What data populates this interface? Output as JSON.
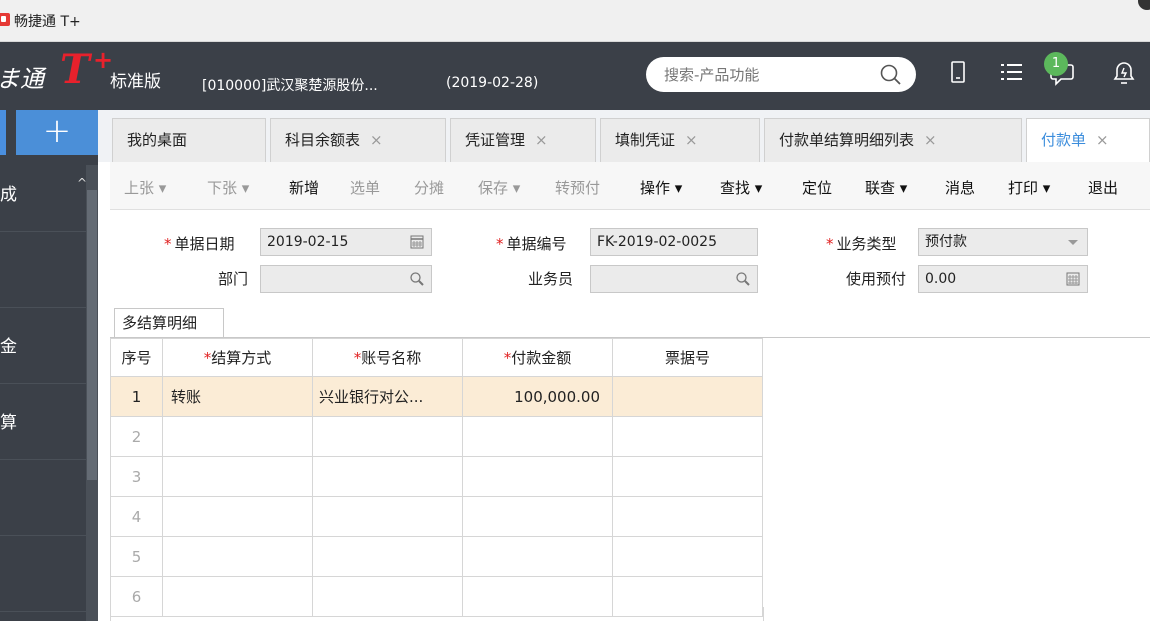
{
  "window": {
    "title": "畅捷通 T+"
  },
  "header": {
    "brand_part": "ま通",
    "brand_t": "T",
    "brand_plus": "+",
    "edition": "标准版",
    "company": "[010000]武汉聚楚源股份...",
    "date": "(2019-02-28)",
    "search_placeholder": "搜索-产品功能",
    "notification_count": "1",
    "colors": {
      "header_bg": "#3b4048",
      "brand_red": "#e8212c",
      "accent_blue": "#3c8ddc"
    }
  },
  "sidebar": {
    "add_label": "+",
    "items": [
      {
        "label": "成"
      },
      {
        "label": ""
      },
      {
        "label": "金"
      },
      {
        "label": "算"
      },
      {
        "label": ""
      },
      {
        "label": ""
      }
    ]
  },
  "tabs": [
    {
      "label": "我的桌面",
      "closable": false
    },
    {
      "label": "科目余额表",
      "closable": true
    },
    {
      "label": "凭证管理",
      "closable": true
    },
    {
      "label": "填制凭证",
      "closable": true
    },
    {
      "label": "付款单结算明细列表",
      "closable": true
    },
    {
      "label": "付款单",
      "closable": true,
      "active": true
    }
  ],
  "tab_close_glyph": "×",
  "toolbar": {
    "prev": "上张 ▾",
    "next": "下张 ▾",
    "new": "新增",
    "select": "选单",
    "split": "分摊",
    "save": "保存 ▾",
    "prepay": "转预付",
    "operate": "操作 ▾",
    "find": "查找 ▾",
    "locate": "定位",
    "link": "联查 ▾",
    "message": "消息",
    "print": "打印 ▾",
    "exit": "退出"
  },
  "form": {
    "req_mark": "*",
    "doc_date_label": "单据日期",
    "doc_date_value": "2019-02-15",
    "doc_no_label": "单据编号",
    "doc_no_value": "FK-2019-02-0025",
    "biz_type_label": "业务类型",
    "biz_type_value": "预付款",
    "dept_label": "部门",
    "dept_value": "",
    "staff_label": "业务员",
    "staff_value": "",
    "use_prepay_label": "使用预付",
    "use_prepay_value": "0.00"
  },
  "detail": {
    "tab_label": "多结算明细",
    "req_mark": "*",
    "columns": {
      "seq": "序号",
      "method": "结算方式",
      "account": "账号名称",
      "amount": "付款金额",
      "ticket": "票据号"
    },
    "rows": [
      {
        "seq": "1",
        "method": "转账",
        "account": "兴业银行对公...",
        "amount": "100,000.00",
        "ticket": ""
      },
      {
        "seq": "2",
        "method": "",
        "account": "",
        "amount": "",
        "ticket": ""
      },
      {
        "seq": "3",
        "method": "",
        "account": "",
        "amount": "",
        "ticket": ""
      },
      {
        "seq": "4",
        "method": "",
        "account": "",
        "amount": "",
        "ticket": ""
      },
      {
        "seq": "5",
        "method": "",
        "account": "",
        "amount": "",
        "ticket": ""
      },
      {
        "seq": "6",
        "method": "",
        "account": "",
        "amount": "",
        "ticket": ""
      }
    ]
  }
}
